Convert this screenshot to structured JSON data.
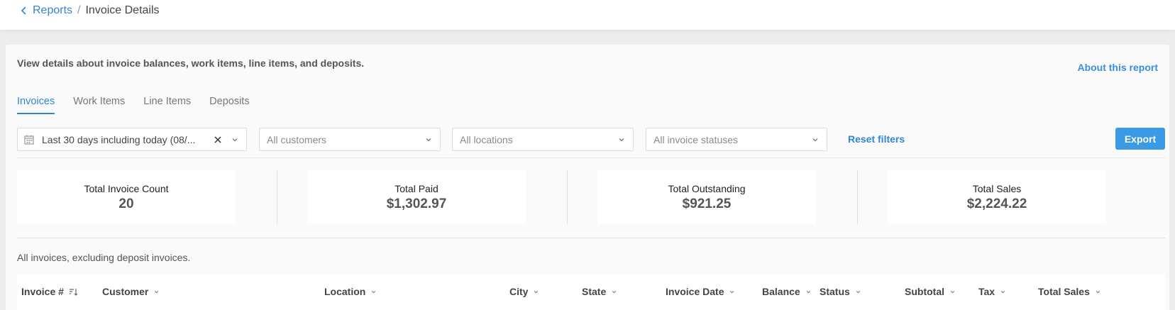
{
  "breadcrumb": {
    "parent": "Reports",
    "separator": "/",
    "current": "Invoice Details"
  },
  "intro": "View details about invoice balances, work items, line items, and deposits.",
  "about_link": "About this report",
  "tabs": [
    {
      "label": "Invoices",
      "active": true
    },
    {
      "label": "Work Items",
      "active": false
    },
    {
      "label": "Line Items",
      "active": false
    },
    {
      "label": "Deposits",
      "active": false
    }
  ],
  "filters": {
    "date_range": "Last 30 days including today (08/...",
    "customers_placeholder": "All customers",
    "locations_placeholder": "All locations",
    "statuses_placeholder": "All invoice statuses",
    "reset": "Reset filters",
    "export": "Export"
  },
  "stats": [
    {
      "label": "Total Invoice Count",
      "value": "20"
    },
    {
      "label": "Total Paid",
      "value": "$1,302.97"
    },
    {
      "label": "Total Outstanding",
      "value": "$921.25"
    },
    {
      "label": "Total Sales",
      "value": "$2,224.22"
    }
  ],
  "table_note": "All invoices, excluding deposit invoices.",
  "columns": [
    {
      "label": "Invoice #",
      "icon": "sort-icon"
    },
    {
      "label": "Customer",
      "icon": "chevron-down-icon"
    },
    {
      "label": "Location",
      "icon": "chevron-down-icon"
    },
    {
      "label": "City",
      "icon": "chevron-down-icon"
    },
    {
      "label": "State",
      "icon": "chevron-down-icon"
    },
    {
      "label": "Invoice Date",
      "icon": "chevron-down-icon"
    },
    {
      "label": "Balance",
      "icon": "chevron-down-icon"
    },
    {
      "label": "Status",
      "icon": "chevron-down-icon"
    },
    {
      "label": "Subtotal",
      "icon": "chevron-down-icon"
    },
    {
      "label": "Tax",
      "icon": "chevron-down-icon"
    },
    {
      "label": "Total Sales",
      "icon": "chevron-down-icon"
    }
  ],
  "colors": {
    "accent": "#2f86d4",
    "button": "#3a9ae6"
  }
}
